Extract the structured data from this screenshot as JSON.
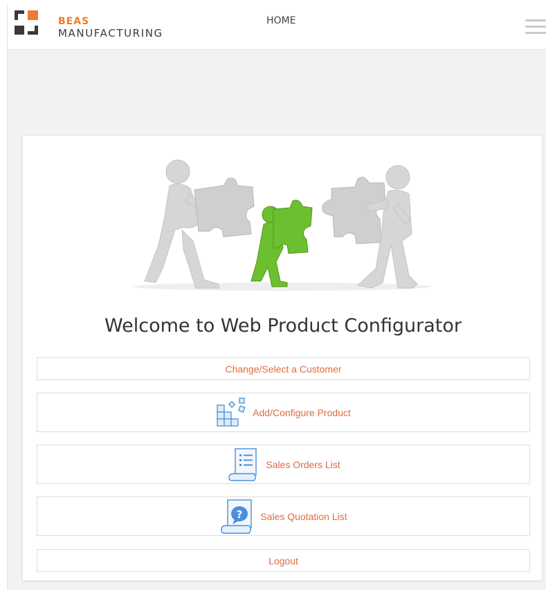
{
  "header": {
    "brand_top": "BEAS",
    "brand_bottom": "MANUFACTURING",
    "nav_home": "HOME"
  },
  "main": {
    "welcome_title": "Welcome to Web Product Configurator",
    "menu": [
      {
        "label": "Change/Select a Customer",
        "icon": ""
      },
      {
        "label": "Add/Configure Product",
        "icon": "configure-product-icon"
      },
      {
        "label": "Sales Orders List",
        "icon": "list-document-icon"
      },
      {
        "label": "Sales Quotation List",
        "icon": "quotation-question-icon"
      },
      {
        "label": "Logout",
        "icon": ""
      }
    ]
  },
  "colors": {
    "brand_orange": "#f07a30",
    "link_orange": "#e06a3c",
    "page_bg": "#f2f2f2",
    "card_bg": "#ffffff",
    "puzzle_green": "#6cbf2f",
    "icon_blue": "#4a90d9"
  }
}
